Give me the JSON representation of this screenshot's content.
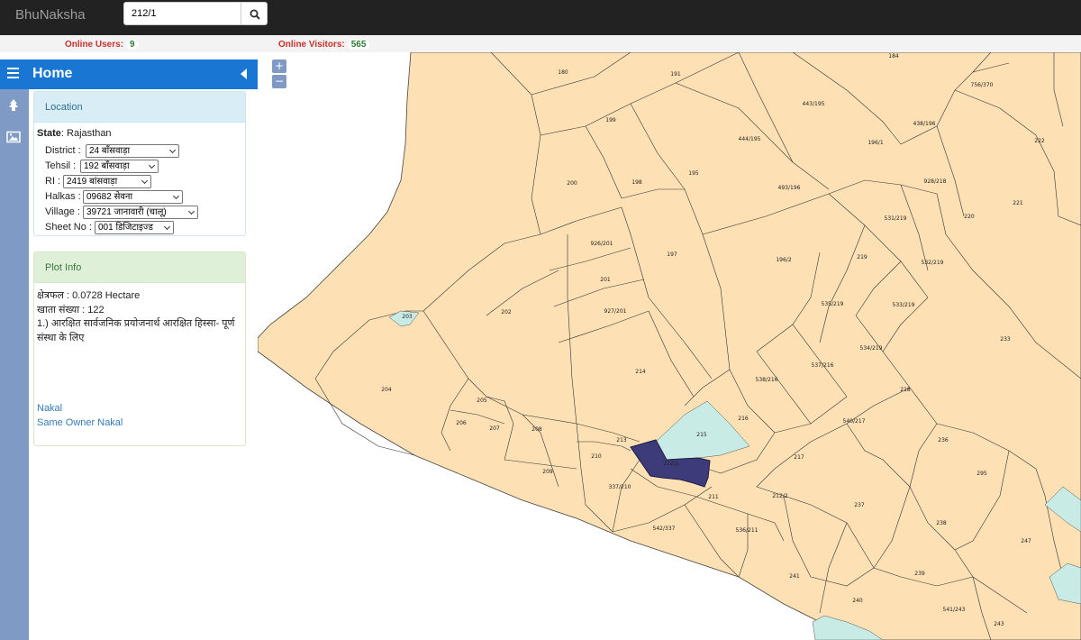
{
  "app": {
    "brand": "BhuNaksha"
  },
  "search": {
    "value": "212/1",
    "icon": "search-icon"
  },
  "stats": {
    "users_label": "Online Users:",
    "users_value": "9",
    "visitors_label": "Online Visitors:",
    "visitors_value": "565"
  },
  "sidebar": {
    "title": "Home",
    "nav_icons": [
      "tree-icon",
      "image-icon"
    ],
    "location": {
      "heading": "Location",
      "state_label": "State",
      "state_value": ": Rajasthan",
      "fields": [
        {
          "label": "District :",
          "value": "24 बाँसवाड़ा"
        },
        {
          "label": "Tehsil :",
          "value": "192 बाँसवाड़ा"
        },
        {
          "label": "RI :",
          "value": "2419 बांसवाड़ा"
        },
        {
          "label": "Halkas :",
          "value": "09682 सेवना"
        },
        {
          "label": "Village :",
          "value": "39721 जानावारी (चालू)"
        },
        {
          "label": "Sheet No :",
          "value": "001 डिजिटाइज्ड"
        }
      ]
    },
    "plot_info": {
      "heading": "Plot Info",
      "area": "क्षेत्रफल : 0.0728 Hectare",
      "khata": "खाता संख्या : 122",
      "note_line1": "1.) आरक्षित सार्वजनिक प्रयोजनार्थ आरक्षित हिस्सा- पूर्ण",
      "note_line2": "संस्था के लिए",
      "nakal": "Nakal",
      "same_owner_nakal": "Same Owner Nakal"
    }
  },
  "map": {
    "zoom_in": "+",
    "zoom_out": "−",
    "colors": {
      "parcel": "#fde0b3",
      "water": "#c9ebe6",
      "selected": "#3d3b7a",
      "border": "#333333"
    },
    "plot_labels": [
      "180",
      "191",
      "184",
      "756/370",
      "443/195",
      "438/196",
      "222",
      "199",
      "444/195",
      "196/1",
      "200",
      "195",
      "198",
      "928/218",
      "221",
      "493/196",
      "531/219",
      "220",
      "926/201",
      "197",
      "196/2",
      "219",
      "532/219",
      "201",
      "535/219",
      "533/219",
      "202",
      "927/201",
      "233",
      "534/219",
      "537/216",
      "203",
      "214",
      "218",
      "204",
      "205",
      "538/216",
      "540/217",
      "236",
      "206",
      "207",
      "208",
      "216",
      "215",
      "210",
      "213",
      "217",
      "295",
      "209",
      "212/1",
      "337/210",
      "211",
      "212/2",
      "237",
      "542/337",
      "536/211",
      "238",
      "247",
      "241",
      "239",
      "240",
      "541/243",
      "243"
    ]
  }
}
